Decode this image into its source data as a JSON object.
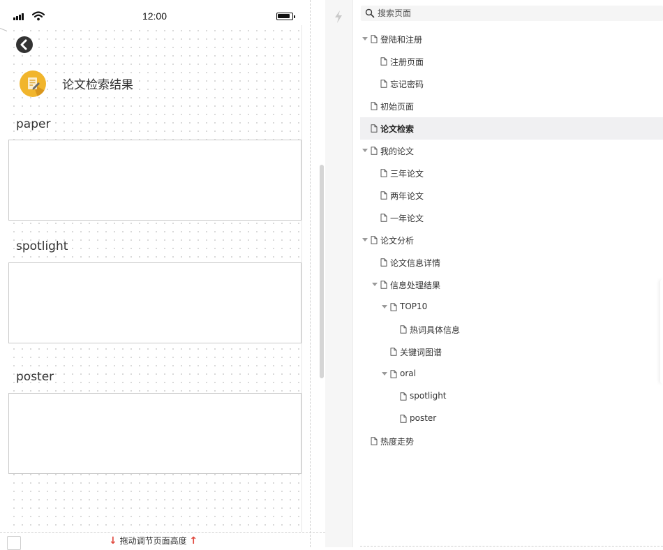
{
  "status_bar": {
    "time": "12:00"
  },
  "page": {
    "title": "论文检索结果"
  },
  "sections": [
    {
      "label": "paper"
    },
    {
      "label": "spotlight"
    },
    {
      "label": "poster"
    }
  ],
  "footer": {
    "drag_hint": "拖动调节页面高度"
  },
  "search": {
    "placeholder": "搜索页面"
  },
  "tree": [
    {
      "label": "登陆和注册",
      "level": 0,
      "expandable": true,
      "selected": false
    },
    {
      "label": "注册页面",
      "level": 1,
      "expandable": false,
      "selected": false
    },
    {
      "label": "忘记密码",
      "level": 1,
      "expandable": false,
      "selected": false
    },
    {
      "label": "初始页面",
      "level": 0,
      "expandable": false,
      "selected": false
    },
    {
      "label": "论文检索",
      "level": 0,
      "expandable": false,
      "selected": true
    },
    {
      "label": "我的论文",
      "level": 0,
      "expandable": true,
      "selected": false
    },
    {
      "label": "三年论文",
      "level": 1,
      "expandable": false,
      "selected": false
    },
    {
      "label": "两年论文",
      "level": 1,
      "expandable": false,
      "selected": false
    },
    {
      "label": "一年论文",
      "level": 1,
      "expandable": false,
      "selected": false
    },
    {
      "label": "论文分析",
      "level": 0,
      "expandable": true,
      "selected": false
    },
    {
      "label": "论文信息详情",
      "level": 1,
      "expandable": false,
      "selected": false
    },
    {
      "label": "信息处理结果",
      "level": 1,
      "expandable": true,
      "selected": false
    },
    {
      "label": "TOP10",
      "level": 2,
      "expandable": true,
      "selected": false
    },
    {
      "label": "热词具体信息",
      "level": 3,
      "expandable": false,
      "selected": false
    },
    {
      "label": "关键词图谱",
      "level": 2,
      "expandable": false,
      "selected": false
    },
    {
      "label": "oral",
      "level": 2,
      "expandable": true,
      "selected": false
    },
    {
      "label": "spotlight",
      "level": 3,
      "expandable": false,
      "selected": false
    },
    {
      "label": "poster",
      "level": 3,
      "expandable": false,
      "selected": false
    },
    {
      "label": "热度走势",
      "level": 0,
      "expandable": false,
      "selected": false
    }
  ],
  "icons": {
    "back": "chevron-left-circle-icon",
    "logo": "document-edit-icon",
    "search": "search-icon",
    "bolt": "lightning-icon",
    "page": "page-icon"
  },
  "colors": {
    "logo": "#f1b52c",
    "selected_row": "#f0f0f2",
    "arrow": "#e0483d"
  }
}
